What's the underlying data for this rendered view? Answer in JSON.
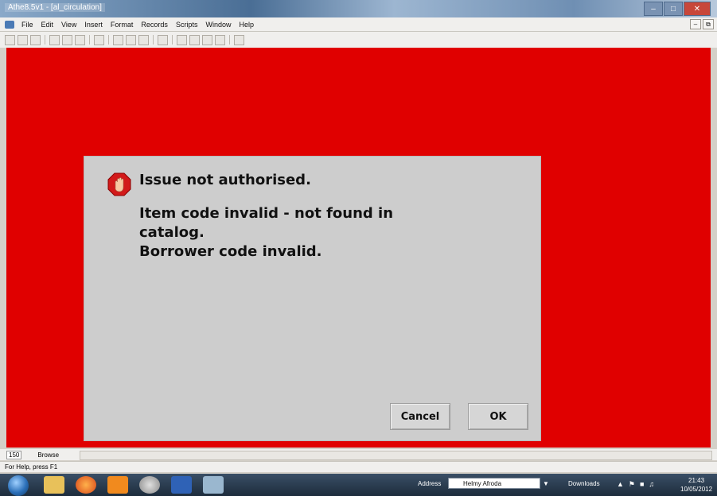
{
  "window": {
    "title": "Athe8.5v1 - [al_circulation]"
  },
  "menu": {
    "items": [
      "File",
      "Edit",
      "View",
      "Insert",
      "Format",
      "Records",
      "Scripts",
      "Window",
      "Help"
    ]
  },
  "dialog": {
    "icon": "stop-hand-icon",
    "line1": "Issue not authorised.",
    "line2": "Item code invalid - not found in",
    "line3": "catalog.",
    "line4": "Borrower code invalid.",
    "cancel_label": "Cancel",
    "ok_label": "OK"
  },
  "status": {
    "zoom": "150",
    "mode": "Browse",
    "help": "For Help, press F1"
  },
  "taskbar": {
    "address_label": "Address",
    "address_value": "Helmy Afroda",
    "downloads_label": "Downloads",
    "time": "21:43",
    "date": "10/05/2012"
  },
  "colors": {
    "workspace": "#e00000",
    "dialog": "#cdcdcd"
  }
}
